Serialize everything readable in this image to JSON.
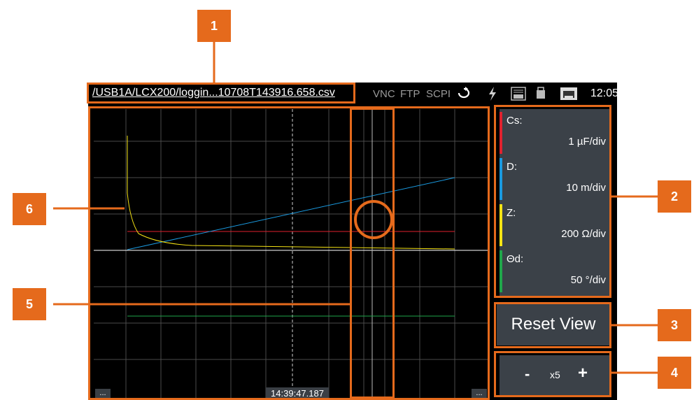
{
  "statusbar": {
    "path": "/USB1A/LCX200/loggin...10708T143916.658.csv",
    "services": [
      "VNC",
      "FTP",
      "SCPI"
    ],
    "icons": [
      "remote-refresh-icon",
      "lightning-icon",
      "log-icon",
      "usb-storage-icon",
      "lan-icon"
    ],
    "clock": "12:05"
  },
  "plot": {
    "timestamp": "14:39:47.187",
    "left_dots": "...",
    "right_dots": "..."
  },
  "channels": [
    {
      "name": "Cs:",
      "scale": "1 µF/div",
      "color": "#e0212e"
    },
    {
      "name": "D:",
      "scale": "10 m/div",
      "color": "#1a9ae0"
    },
    {
      "name": "Z:",
      "scale": "200 Ω/div",
      "color": "#f5e314"
    },
    {
      "name": "Θd:",
      "scale": "50 °/div",
      "color": "#1fa64a"
    }
  ],
  "controls": {
    "reset_label": "Reset View",
    "zoom_minus": "-",
    "zoom_factor": "x5",
    "zoom_plus": "+"
  },
  "callouts": [
    "1",
    "2",
    "3",
    "4",
    "5",
    "6"
  ],
  "colors": {
    "accent": "#e56a1c",
    "panel": "#3b4148",
    "grid": "#4a4a4a"
  }
}
